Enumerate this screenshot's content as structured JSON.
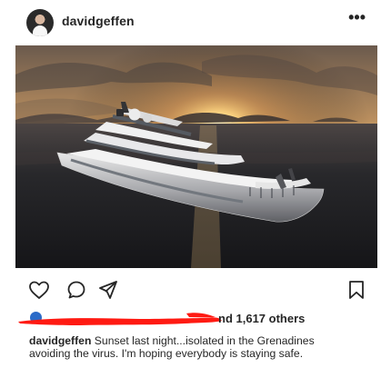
{
  "post": {
    "username": "davidgeffen",
    "more_glyph": "•••",
    "image_alt": "Yacht at sunset near islands"
  },
  "actions": {
    "like_icon": "heart-icon",
    "comment_icon": "comment-icon",
    "share_icon": "send-icon",
    "save_icon": "bookmark-icon"
  },
  "likes": {
    "text": "nd 1,617 others"
  },
  "caption": {
    "username": "davidgeffen",
    "line1": "Sunset last night...isolated in the Grenadines",
    "line2": "avoiding the virus.  I'm hoping everybody is staying safe."
  },
  "colors": {
    "text": "#262626",
    "redaction": "#ff1a12",
    "avatar_blue": "#2b6bc8"
  }
}
